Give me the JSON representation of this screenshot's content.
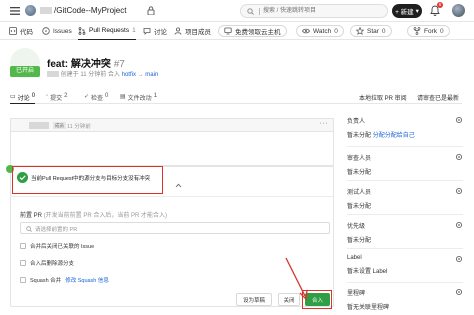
{
  "header": {
    "repo_path": "GitCode--MyProject",
    "search_placeholder": "搜索 / 快速跳转项目",
    "new_label": "+ 新建",
    "notification_count": "6"
  },
  "repo_tabs": [
    {
      "label": "代码",
      "count": "",
      "icon": "code-icon"
    },
    {
      "label": "Issues",
      "count": "",
      "icon": "issue-icon"
    },
    {
      "label": "Pull Requests",
      "count": "1",
      "icon": "pull-request-icon"
    },
    {
      "label": "讨论",
      "count": "",
      "icon": "discussion-icon"
    },
    {
      "label": "项目成员",
      "count": "",
      "icon": "members-icon"
    }
  ],
  "repo_actions": {
    "free_host": "免费领取云主机",
    "watch_label": "Watch",
    "watch_count": "0",
    "star_label": "Star",
    "star_count": "0",
    "fork_label": "Fork",
    "fork_count": "0"
  },
  "pr": {
    "status": "已开启",
    "title": "feat: 解决冲突",
    "number": "#7",
    "created_text": "创建于 11 分钟前",
    "merge_text": "合入",
    "source_branch": "hotfix",
    "target_branch": "main"
  },
  "subtabs": [
    {
      "label": "讨论",
      "count": "0",
      "icon": "discussion-icon"
    },
    {
      "label": "提交",
      "count": "2",
      "icon": "commit-icon"
    },
    {
      "label": "检查",
      "count": "0",
      "icon": "check-icon"
    },
    {
      "label": "文件改动",
      "count": "1",
      "icon": "file-icon"
    }
  ],
  "review_links": {
    "local_review": "本地拉取 PR 审阅",
    "mark_read": "请审查已是最新"
  },
  "comment": {
    "role_tag": "成员",
    "time": "11 分钟前"
  },
  "merge": {
    "conflict_text": "当前Pull Request中的源分支与目标分支没有冲突",
    "pre_pr_label": "前置 PR",
    "pre_pr_hint": "(开发当前前置 PR 合入后，当前 PR 才能合入)",
    "pre_pr_placeholder": "请选择前置的 PR",
    "options": [
      {
        "label": "合并后关闭已关联的 Issue"
      },
      {
        "label": "合入后删除源分支"
      },
      {
        "label": "Squash 合并",
        "link": "修改 Squash 信息"
      }
    ],
    "save_draft": "设为草稿",
    "close_label": "关闭",
    "merge_label": "合入"
  },
  "sidebar": [
    {
      "label": "负责人",
      "value_link": "分配",
      "value_text": "暂未分配",
      "value_link2": "分配给自己"
    },
    {
      "label": "审查人员",
      "value_text": "暂未分配"
    },
    {
      "label": "测试人员",
      "value_text": "暂未分配"
    },
    {
      "label": "优先级",
      "value_text": "暂未分配"
    },
    {
      "label": "Label",
      "value_text": "暂未设置 Label"
    },
    {
      "label": "里程碑",
      "value_text": "暂无关联里程碑"
    }
  ],
  "colors": {
    "accent_green": "#2f9e44",
    "highlight_red": "#d9342b",
    "link_blue": "#1a63d6"
  }
}
